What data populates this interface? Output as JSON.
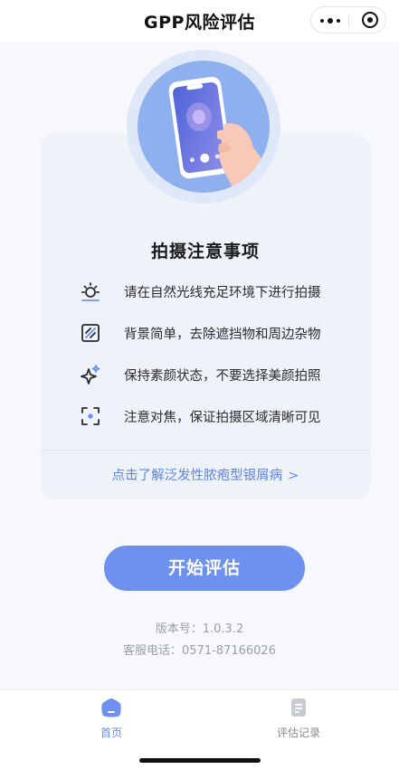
{
  "header": {
    "title": "GPP风险评估"
  },
  "card": {
    "title": "拍摄注意事项",
    "tips": [
      {
        "icon": "sun-icon",
        "text": "请在自然光线充足环境下进行拍摄"
      },
      {
        "icon": "background-icon",
        "text": "背景简单，去除遮挡物和周边杂物"
      },
      {
        "icon": "sparkle-icon",
        "text": "保持素颜状态，不要选择美颜拍照"
      },
      {
        "icon": "focus-icon",
        "text": "注意对焦，保证拍摄区域清晰可见"
      }
    ],
    "link_label": "点击了解泛发性脓疱型银屑病",
    "link_chevron": ">"
  },
  "start_button": {
    "label": "开始评估"
  },
  "info": {
    "version": "版本号：1.0.3.2",
    "phone": "客服电话：0571-87166026"
  },
  "tabbar": {
    "items": [
      {
        "label": "首页",
        "icon": "home-icon",
        "active": true
      },
      {
        "label": "评估记录",
        "icon": "records-icon",
        "active": false
      }
    ]
  },
  "colors": {
    "accent": "#6e90ee",
    "link": "#5f84e8",
    "card_bg": "#eef2f9",
    "hero": "#8fb0ef"
  }
}
